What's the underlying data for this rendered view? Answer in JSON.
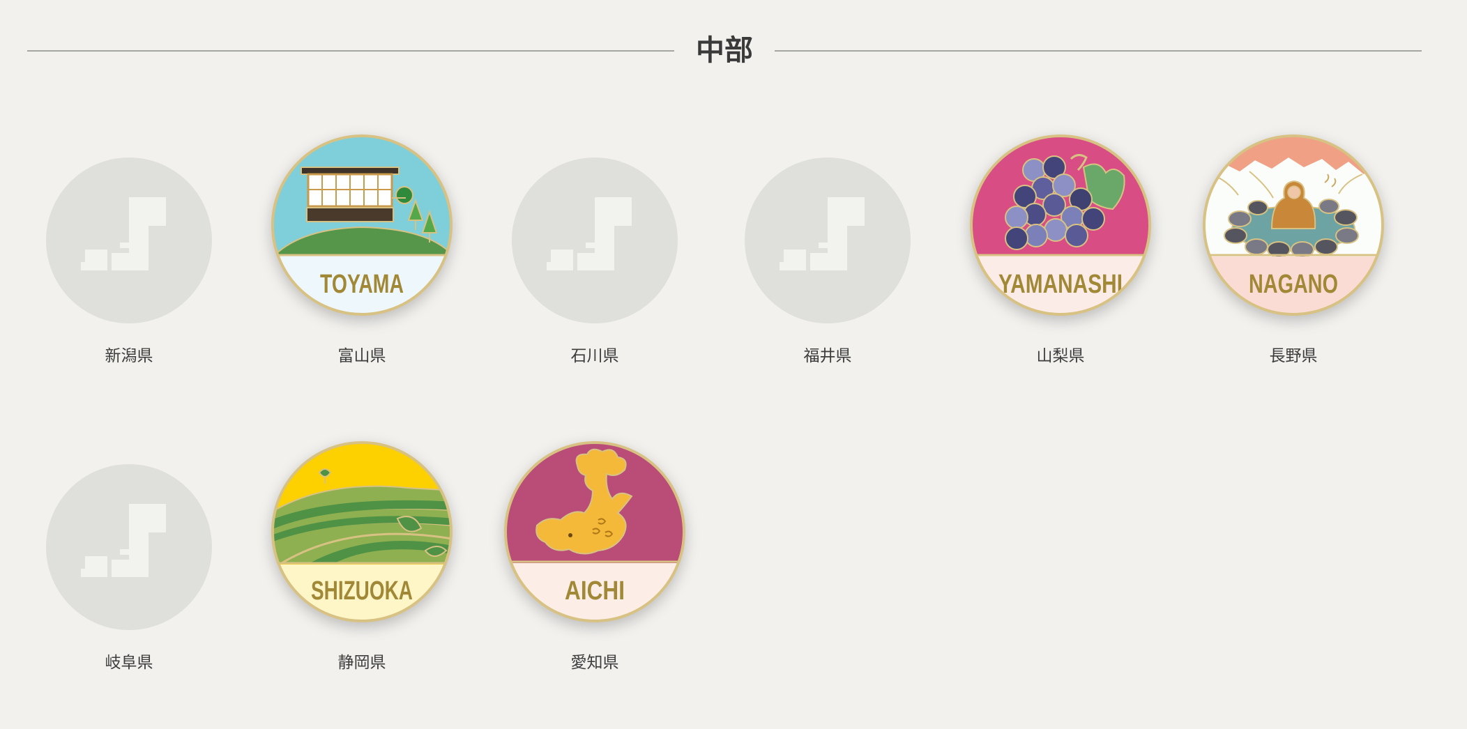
{
  "region": {
    "title": "中部"
  },
  "prefectures": [
    {
      "name": "新潟県",
      "collected": false
    },
    {
      "name": "富山県",
      "collected": true,
      "badge_text": "TOYAMA",
      "badge_icon": "observatory-hill-icon"
    },
    {
      "name": "石川県",
      "collected": false
    },
    {
      "name": "福井県",
      "collected": false
    },
    {
      "name": "山梨県",
      "collected": true,
      "badge_text": "YAMANASHI",
      "badge_icon": "grapes-icon"
    },
    {
      "name": "長野県",
      "collected": true,
      "badge_text": "NAGANO",
      "badge_icon": "snow-monkey-onsen-icon"
    },
    {
      "name": "岐阜県",
      "collected": false
    },
    {
      "name": "静岡県",
      "collected": true,
      "badge_text": "SHIZUOKA",
      "badge_icon": "tea-field-icon"
    },
    {
      "name": "愛知県",
      "collected": true,
      "badge_text": "AICHI",
      "badge_icon": "golden-shachihoko-icon"
    }
  ],
  "colors": {
    "background": "#f2f1ee",
    "placeholder_circle": "#dfdfdb",
    "placeholder_map": "#f2f2ef",
    "badge_rim": "#d8c283",
    "badge_label": "#a08836"
  }
}
